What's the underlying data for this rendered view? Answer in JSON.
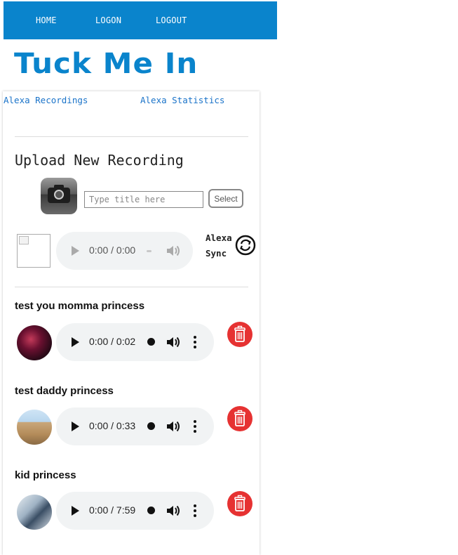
{
  "nav": {
    "home": "HOME",
    "logon": "LOGON",
    "logout": "LOGOUT"
  },
  "brand": "Tuck Me In",
  "subnav": {
    "recordings": "Alexa Recordings",
    "statistics": "Alexa Statistics"
  },
  "upload": {
    "heading": "Upload New Recording",
    "title_placeholder": "Type title here",
    "title_value": "",
    "select_label": "Select",
    "player_time": "0:00 / 0:00",
    "sync_line1": "Alexa",
    "sync_line2": "Sync"
  },
  "recordings": [
    {
      "title": "test you momma princess",
      "time": "0:00 / 0:02"
    },
    {
      "title": "test daddy princess",
      "time": "0:00 / 0:33"
    },
    {
      "title": "kid princess",
      "time": "0:00 / 7:59"
    }
  ],
  "colors": {
    "nav_bg": "#0a84cc",
    "brand": "#0a84cc",
    "link": "#1a73c9",
    "delete": "#e63232",
    "player_bg": "#f1f3f4"
  },
  "icons": {
    "camera": "camera-icon",
    "sync": "sync-icon",
    "trash": "trash-icon",
    "play": "play-icon",
    "volume": "volume-icon",
    "more": "more-vert-icon"
  }
}
